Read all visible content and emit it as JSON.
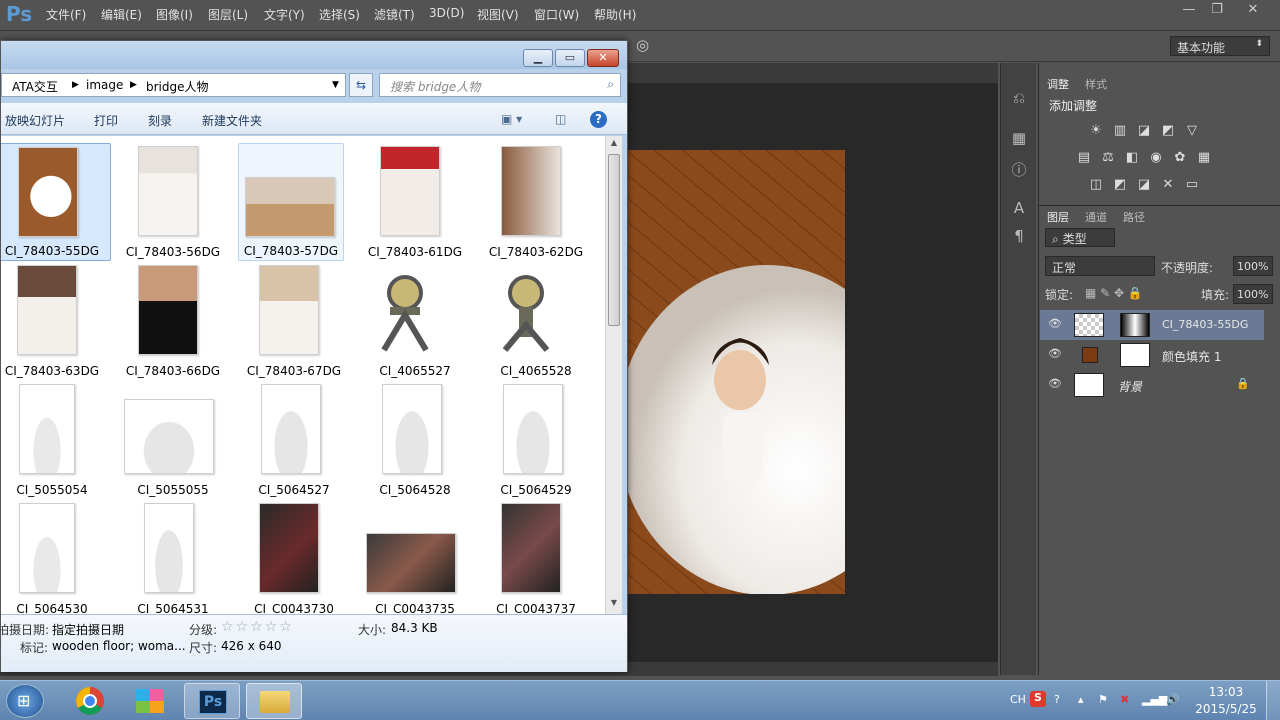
{
  "photoshop": {
    "logo": "Ps",
    "menu": [
      "文件(F)",
      "编辑(E)",
      "图像(I)",
      "图层(L)",
      "文字(Y)",
      "选择(S)",
      "滤镜(T)",
      "3D(D)",
      "视图(V)",
      "窗口(W)",
      "帮助(H)"
    ],
    "workspace": "基本功能",
    "panel_tabs_top": [
      "调整",
      "样式"
    ],
    "adjust_title": "添加调整",
    "panel_tabs_layers": [
      "图层",
      "通道",
      "路径"
    ],
    "filter_kind": "类型",
    "blend_mode": "正常",
    "opacity_label": "不透明度:",
    "opacity_value": "100%",
    "lock_label": "锁定:",
    "fill_label": "填充:",
    "fill_value": "100%",
    "layers": [
      {
        "name": "CI_78403-55DG"
      },
      {
        "name": "颜色填充 1"
      },
      {
        "name": "背景"
      }
    ],
    "colors": {
      "fill_layer": "#7a3a12",
      "ui_dark": "#535353",
      "canvas_bg": "#282828"
    }
  },
  "explorer": {
    "breadcrumb": [
      "ATA交互",
      "image",
      "bridge人物"
    ],
    "search_placeholder": "搜索 bridge人物",
    "toolbar": [
      "放映幻灯片",
      "打印",
      "刻录",
      "新建文件夹"
    ],
    "files": [
      "CI_78403-55DG",
      "CI_78403-56DG",
      "CI_78403-57DG",
      "CI_78403-61DG",
      "CI_78403-62DG",
      "CI_78403-63DG",
      "CI_78403-66DG",
      "CI_78403-67DG",
      "CI_4065527",
      "CI_4065528",
      "CI_5055054",
      "CI_5055055",
      "CI_5064527",
      "CI_5064528",
      "CI_5064529",
      "CI_5064530",
      "CI_5064531",
      "CI_C0043730",
      "CI_C0043735",
      "CI_C0043737"
    ],
    "details": {
      "date_label": "拍摄日期:",
      "date_value": "指定拍摄日期",
      "rating_label": "分级:",
      "rating_value": "☆☆☆☆☆",
      "size_label": "大小:",
      "size_value": "84.3 KB",
      "tags_label": "标记:",
      "tags_value": "wooden floor; woma...",
      "dims_label": "尺寸:",
      "dims_value": "426 x 640"
    }
  },
  "taskbar": {
    "time": "13:03",
    "date": "2015/5/25",
    "lang": "CH",
    "ps_label": "Ps"
  }
}
